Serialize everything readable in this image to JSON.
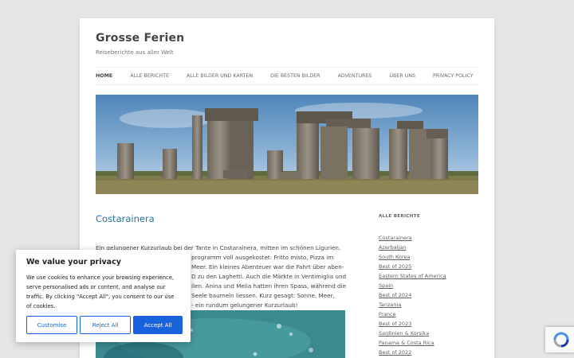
{
  "site": {
    "title": "Grosse Ferien",
    "description": "Reiseberichte aus aller Welt"
  },
  "nav": [
    {
      "label": "HOME"
    },
    {
      "label": "ALLE BERICHTE"
    },
    {
      "label": "ALLE BILDER UND KARTEN"
    },
    {
      "label": "DIE BESTEN BILDER"
    },
    {
      "label": "ADVENTURES"
    },
    {
      "label": "ÜBER UNS"
    },
    {
      "label": "PRIVACY POLICY"
    }
  ],
  "post": {
    "title": "Costarainera",
    "lines": [
      "Ein gelungener Kurzurlaub bei der Tante in Costarainera, mitten im schönen Ligurien.",
      "programm voll ausgekostet: Fritto misto, Pizza im",
      "Meer. Ein kleines Abenteuer war die Fahrt über aben-",
      "D zu den Laghetti. Auch die Märkte in Ventimiglia und",
      "ilen. Anina und Melia hatten ihren Spass, während die",
      "Seele baumeln liessen. Kurz gesagt: Sonne, Meer,",
      "- ein rundum gelungener Kurzurlaub!"
    ]
  },
  "sidebar": {
    "heading": "ALLE BERICHTE",
    "items": [
      {
        "label": "Costarainera"
      },
      {
        "label": "Azerbaijan"
      },
      {
        "label": "South Korea"
      },
      {
        "label": "Best of 2025"
      },
      {
        "label": "Eastern States of America"
      },
      {
        "label": "Spain"
      },
      {
        "label": "Best of 2024"
      },
      {
        "label": "Tanzania"
      },
      {
        "label": "France"
      },
      {
        "label": "Best of 2023"
      },
      {
        "label": "Sardinien & Korsika"
      },
      {
        "label": "Panama & Costa Rica"
      },
      {
        "label": "Best of 2022"
      }
    ]
  },
  "cookie": {
    "title": "We value your privacy",
    "text": [
      "We use cookies to enhance your browsing experience,",
      "serve personalised ads or content, and analyse our",
      "traffic. By clicking \"Accept All\", you consent to our use",
      "of cookies."
    ],
    "customise": "Customise",
    "reject": "Reject All",
    "accept": "Accept All"
  },
  "colors": {
    "link": "#21759b",
    "primary_button": "#1863dc",
    "background": "#e6e6e6"
  }
}
